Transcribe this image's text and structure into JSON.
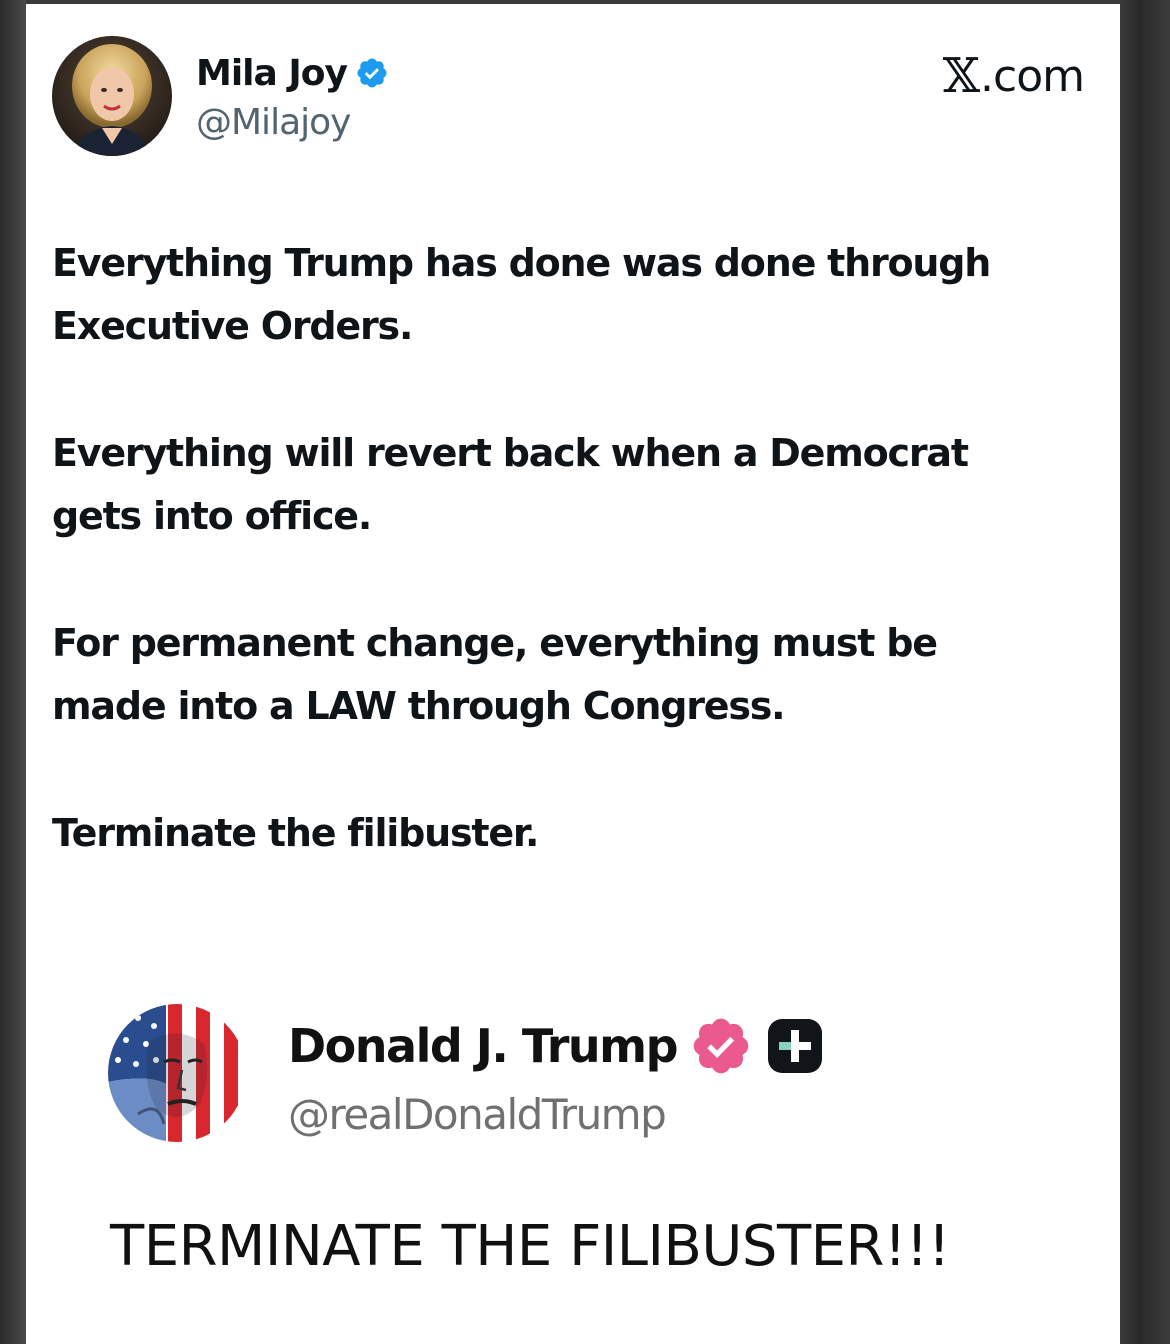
{
  "post": {
    "author_name": "Mila Joy",
    "author_handle": "@Milajoy",
    "site_label": ".com",
    "site_logo": "𝕏",
    "paragraphs": [
      "Everything Trump has done was done through\nExecutive Orders.",
      "Everything will revert back when a Democrat\ngets into office.",
      "For permanent change, everything must be\nmade into a LAW through Congress.",
      "Terminate the filibuster."
    ],
    "verified_color": "#1d9bf0",
    "avatar_icon": "woman-portrait-avatar"
  },
  "quoted_post": {
    "author_name": "Donald J. Trump",
    "author_handle": "@realDonaldTrump",
    "text": "TERMINATE THE FILIBUSTER!!!",
    "verified_color": "#ea5a8f",
    "avatar_icon": "american-flag-portrait-avatar"
  }
}
